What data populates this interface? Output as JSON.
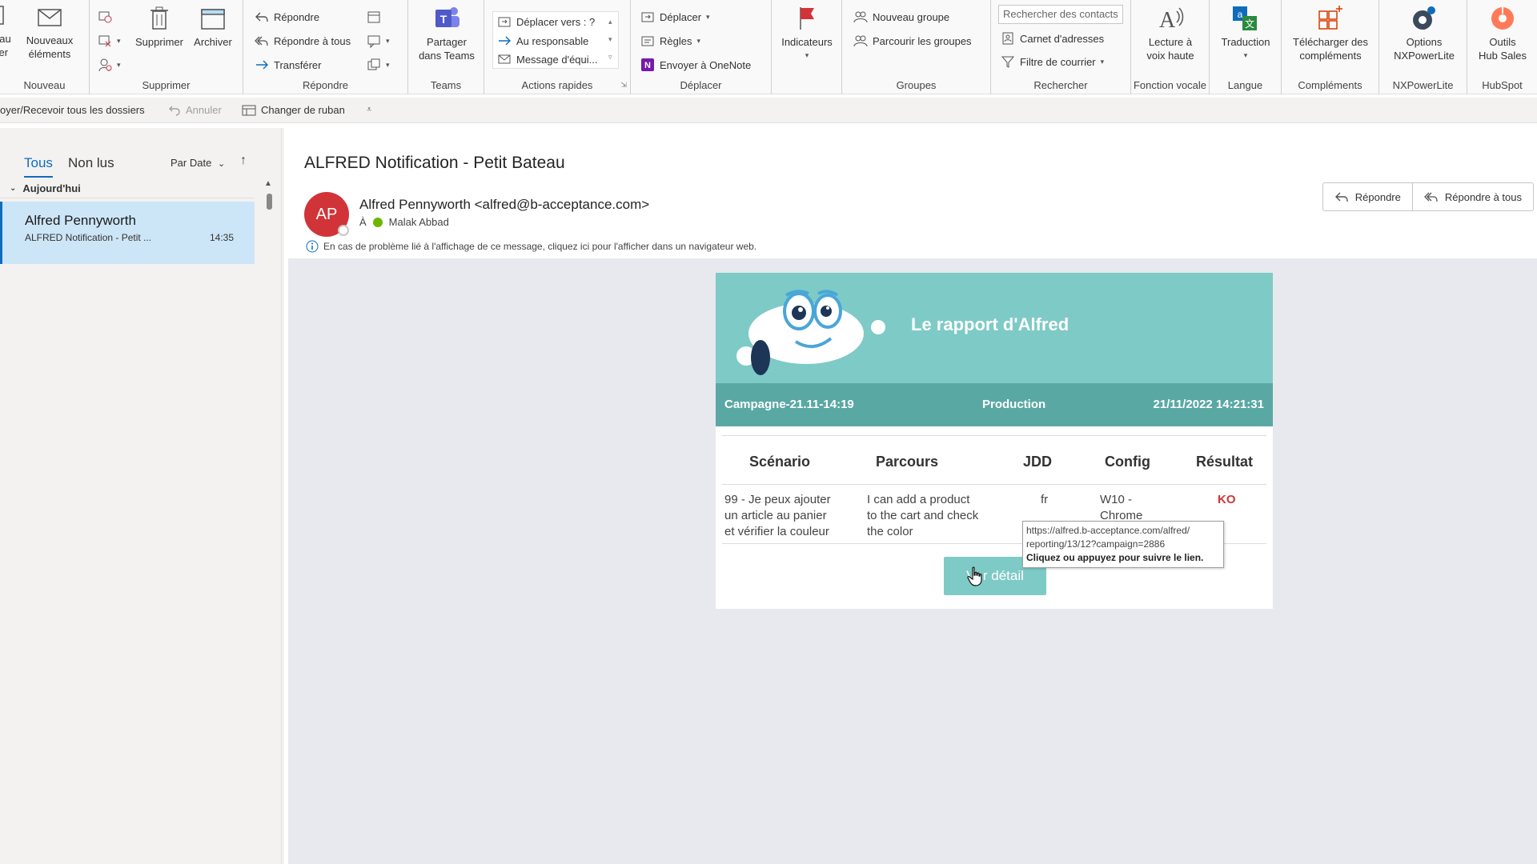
{
  "ribbon": {
    "nouveau": {
      "label": "Nouveau",
      "partial_btn": "eau\nier",
      "new_items": "Nouveaux\néléments"
    },
    "supprimer": {
      "label": "Supprimer",
      "delete": "Supprimer",
      "archive": "Archiver"
    },
    "repondre": {
      "label": "Répondre",
      "reply": "Répondre",
      "reply_all": "Répondre à tous",
      "forward": "Transférer"
    },
    "teams": {
      "label": "Teams",
      "share": "Partager\ndans Teams"
    },
    "actions_rapides": {
      "label": "Actions rapides",
      "move_to": "Déplacer vers : ?",
      "to_manager": "Au responsable",
      "team_message": "Message d'équi..."
    },
    "deplacer": {
      "label": "Déplacer",
      "move": "Déplacer",
      "rules": "Règles",
      "onenote": "Envoyer à OneNote"
    },
    "indicateurs": {
      "label": "Indicateurs"
    },
    "groupes": {
      "label": "Groupes",
      "new_group": "Nouveau groupe",
      "browse_groups": "Parcourir les groupes"
    },
    "rechercher": {
      "label": "Rechercher",
      "search_placeholder": "Rechercher des contacts",
      "address_book": "Carnet d'adresses",
      "filter_mail": "Filtre de courrier"
    },
    "fonction_vocale": {
      "label": "Fonction vocale",
      "read_aloud": "Lecture à\nvoix haute"
    },
    "langue": {
      "label": "Langue",
      "translate": "Traduction"
    },
    "complements": {
      "label": "Compléments",
      "get_addins": "Télécharger des\ncompléments"
    },
    "nxpowerlite": {
      "label": "NXPowerLite",
      "options": "Options\nNXPowerLite"
    },
    "hubspot": {
      "label": "HubSpot",
      "tools": "Outils\nHub Sales"
    }
  },
  "qat": {
    "send_receive": "oyer/Recevoir tous les dossiers",
    "undo": "Annuler",
    "change_ribbon": "Changer de ruban"
  },
  "maillist": {
    "tab_all": "Tous",
    "tab_unread": "Non lus",
    "sort": "Par Date",
    "group_today": "Aujourd'hui",
    "items": [
      {
        "sender": "Alfred Pennyworth",
        "subject": "ALFRED Notification - Petit ...",
        "time": "14:35"
      }
    ]
  },
  "message": {
    "subject": "ALFRED Notification - Petit Bateau",
    "avatar_initials": "AP",
    "from": "Alfred Pennyworth <alfred@b-acceptance.com>",
    "to_label": "À",
    "to_name": "Malak Abbad",
    "info_text": "En cas de problème lié à l'affichage de ce message, cliquez ici pour l'afficher dans un navigateur web.",
    "reply": "Répondre",
    "reply_all": "Répondre à tous"
  },
  "email": {
    "title": "Le rapport d'Alfred",
    "campaign": "Campagne-21.11-14:19",
    "environment": "Production",
    "datetime": "21/11/2022 14:21:31",
    "headers": [
      "Scénario",
      "Parcours",
      "JDD",
      "Config",
      "Résultat"
    ],
    "row": {
      "scenario": "99 - Je peux ajouter\nun article au panier\net vérifier la couleur",
      "parcours": "I can add a product\nto the cart and check\nthe color",
      "jdd": "fr",
      "config": "W10 -\nChrome",
      "result": "KO"
    },
    "button": "Voir détail",
    "button_partial": "V  r détail",
    "tooltip_url": "https://alfred.b-acceptance.com/alfred/\nreporting/13/12?campaign=2886",
    "tooltip_hint": "Cliquez ou appuyez pour suivre le lien."
  },
  "colors": {
    "teal_header": "#7ecac6",
    "teal_bar": "#5aa8a4",
    "selection": "#cde6f7",
    "accent": "#0f6cbd",
    "avatar": "#d13438",
    "ko": "#d13438"
  }
}
